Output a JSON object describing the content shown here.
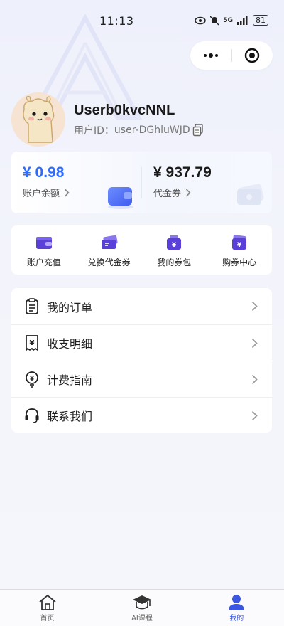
{
  "status_bar": {
    "time": "11:13",
    "network": "5G",
    "battery": "81"
  },
  "profile": {
    "username": "Userb0kvcNNL",
    "user_id_label": "用户ID：",
    "user_id": "user-DGhluWJD"
  },
  "wallet": {
    "balance_amount": "¥ 0.98",
    "balance_label": "账户余额",
    "voucher_amount": "¥ 937.79",
    "voucher_label": "代金券"
  },
  "quick_actions": [
    {
      "label": "账户充值",
      "icon": "wallet-icon"
    },
    {
      "label": "兑换代金券",
      "icon": "ticket-icon"
    },
    {
      "label": "我的券包",
      "icon": "coupon-bag-icon"
    },
    {
      "label": "购券中心",
      "icon": "coupon-center-icon"
    }
  ],
  "menu": [
    {
      "label": "我的订单",
      "icon": "order-icon"
    },
    {
      "label": "收支明细",
      "icon": "receipt-icon"
    },
    {
      "label": "计费指南",
      "icon": "billing-guide-icon"
    },
    {
      "label": "联系我们",
      "icon": "headset-icon"
    }
  ],
  "tabs": [
    {
      "label": "首页",
      "icon": "home-icon",
      "active": false
    },
    {
      "label": "AI课程",
      "icon": "graduation-cap-icon",
      "active": false
    },
    {
      "label": "我的",
      "icon": "user-icon",
      "active": true
    }
  ],
  "colors": {
    "accent": "#2f6bff",
    "tab_active": "#3b56e0",
    "icon_purple": "#5a3fd8"
  }
}
